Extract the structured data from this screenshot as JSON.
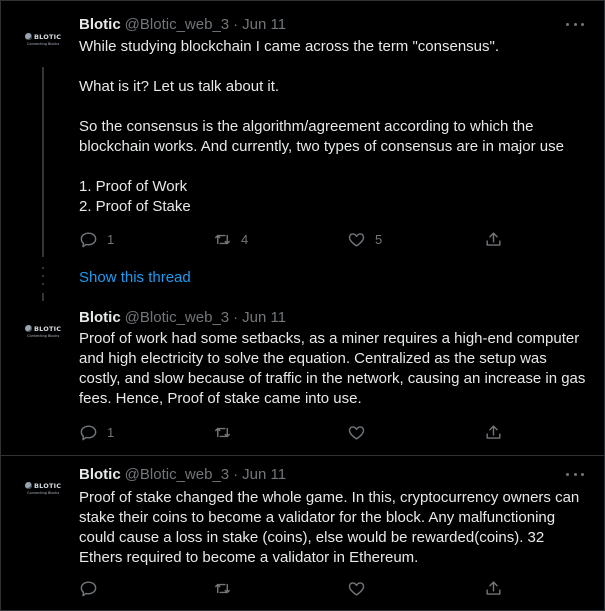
{
  "tweets": [
    {
      "author": "Blotic",
      "handle": "@Blotic_web_3",
      "date": "Jun 11",
      "avatar": {
        "brand": "BLOTIC",
        "tagline": "Connecting Blocks"
      },
      "body": [
        "While studying blockchain I came across the term \"consensus\".",
        "What is it? Let us talk about it.",
        "So the consensus is the algorithm/agreement according to which the blockchain works. And currently, two types of consensus are in major use",
        "1.  Proof of Work",
        "2.  Proof of Stake"
      ],
      "replies": "1",
      "retweets": "4",
      "likes": "5"
    },
    {
      "author": "Blotic",
      "handle": "@Blotic_web_3",
      "date": "Jun 11",
      "avatar": {
        "brand": "BLOTIC",
        "tagline": "Connecting Blocks"
      },
      "body": [
        "Proof of work had some setbacks, as a miner requires a high-end computer and high electricity to solve the equation. Centralized as the setup was costly, and slow because of traffic in the network, causing an increase in gas fees. Hence, Proof of stake came into use."
      ],
      "replies": "1",
      "retweets": "",
      "likes": ""
    },
    {
      "author": "Blotic",
      "handle": "@Blotic_web_3",
      "date": "Jun 11",
      "avatar": {
        "brand": "BLOTIC",
        "tagline": "Connecting Blocks"
      },
      "body": [
        "Proof of stake changed the whole game. In this, cryptocurrency owners can stake their coins to become a validator for the block. Any malfunctioning could cause a loss in stake (coins), else would be rewarded(coins). 32 Ethers required to become a validator in Ethereum."
      ],
      "replies": "",
      "retweets": "",
      "likes": ""
    }
  ],
  "show_thread": "Show this thread",
  "separator_dot": "·",
  "icons": {
    "reply": "reply-icon",
    "retweet": "retweet-icon",
    "like": "like-icon",
    "share": "share-icon",
    "more": "more-icon"
  },
  "colors": {
    "background": "#000000",
    "text": "#e7e9ea",
    "muted": "#71767b",
    "link": "#1d9bf0",
    "border": "#2f3336"
  }
}
